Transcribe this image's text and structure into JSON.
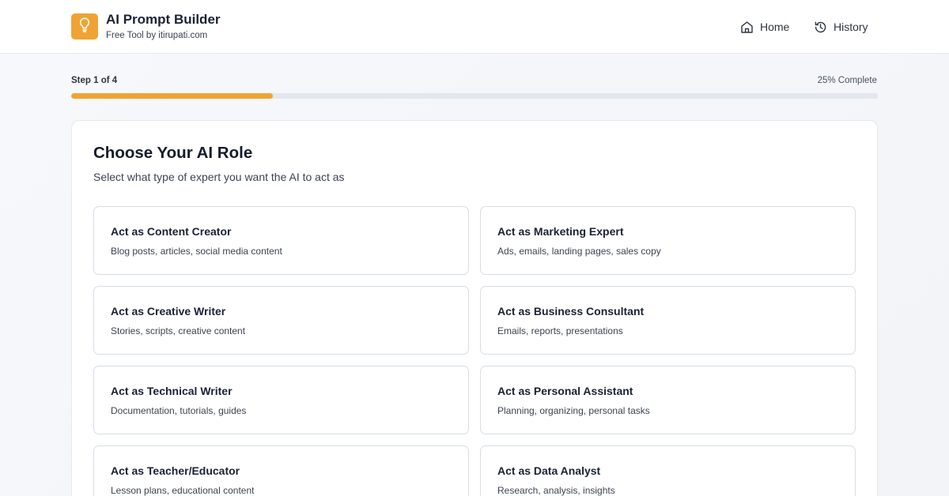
{
  "header": {
    "title": "AI Prompt Builder",
    "subtitle": "Free Tool by itirupati.com",
    "logo_icon": "lightbulb-icon",
    "nav": [
      {
        "label": "Home",
        "icon": "home-icon"
      },
      {
        "label": "History",
        "icon": "history-icon"
      }
    ]
  },
  "progress": {
    "step_label": "Step 1 of 4",
    "percent_label": "25% Complete",
    "fraction": 0.25,
    "color": "#f0a334"
  },
  "main": {
    "title": "Choose Your AI Role",
    "subtitle": "Select what type of expert you want the AI to act as",
    "roles": [
      {
        "title": "Act as Content Creator",
        "desc": "Blog posts, articles, social media content"
      },
      {
        "title": "Act as Marketing Expert",
        "desc": "Ads, emails, landing pages, sales copy"
      },
      {
        "title": "Act as Creative Writer",
        "desc": "Stories, scripts, creative content"
      },
      {
        "title": "Act as Business Consultant",
        "desc": "Emails, reports, presentations"
      },
      {
        "title": "Act as Technical Writer",
        "desc": "Documentation, tutorials, guides"
      },
      {
        "title": "Act as Personal Assistant",
        "desc": "Planning, organizing, personal tasks"
      },
      {
        "title": "Act as Teacher/Educator",
        "desc": "Lesson plans, educational content"
      },
      {
        "title": "Act as Data Analyst",
        "desc": "Research, analysis, insights"
      }
    ]
  }
}
